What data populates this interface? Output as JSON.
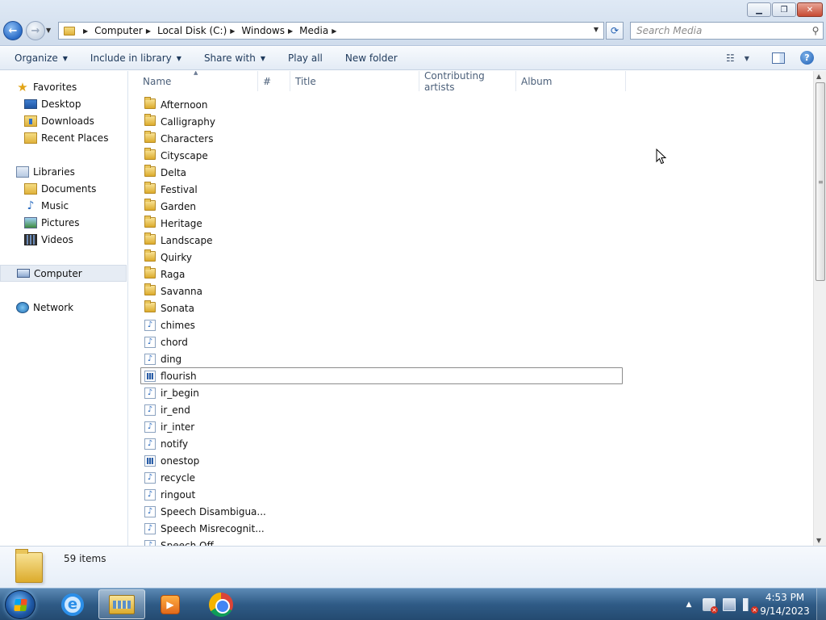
{
  "window": {
    "minimize_icon": "minimize-icon",
    "maximize_icon": "restore-icon",
    "close_icon": "close-icon",
    "minimize_glyph": "▁",
    "maximize_glyph": "❐",
    "close_glyph": "✕"
  },
  "nav_buttons": {
    "back_glyph": "←",
    "forward_glyph": "→",
    "recent_glyph": "▼"
  },
  "address": {
    "crumbs": [
      "Computer",
      "Local Disk (C:)",
      "Windows",
      "Media"
    ],
    "separator": "▶",
    "dropdown_glyph": "▼",
    "refresh_glyph": "⟳"
  },
  "search": {
    "placeholder": "Search Media",
    "icon_glyph": "⚲"
  },
  "toolbar": {
    "organize": "Organize",
    "include_in_library": "Include in library",
    "share_with": "Share with",
    "play_all": "Play all",
    "new_folder": "New folder",
    "caret": "▼",
    "views_glyph": "☷",
    "help_glyph": "?"
  },
  "nav_pane": {
    "favorites": {
      "label": "Favorites",
      "items": [
        "Desktop",
        "Downloads",
        "Recent Places"
      ]
    },
    "libraries": {
      "label": "Libraries",
      "items": [
        "Documents",
        "Music",
        "Pictures",
        "Videos"
      ]
    },
    "computer": "Computer",
    "network": "Network",
    "star_glyph": "★",
    "note_glyph": "♪"
  },
  "columns": [
    "Name",
    "#",
    "Title",
    "Contributing artists",
    "Album"
  ],
  "sort_glyph": "▲",
  "files": [
    {
      "name": "Afternoon",
      "type": "folder"
    },
    {
      "name": "Calligraphy",
      "type": "folder"
    },
    {
      "name": "Characters",
      "type": "folder"
    },
    {
      "name": "Cityscape",
      "type": "folder"
    },
    {
      "name": "Delta",
      "type": "folder"
    },
    {
      "name": "Festival",
      "type": "folder"
    },
    {
      "name": "Garden",
      "type": "folder"
    },
    {
      "name": "Heritage",
      "type": "folder"
    },
    {
      "name": "Landscape",
      "type": "folder"
    },
    {
      "name": "Quirky",
      "type": "folder"
    },
    {
      "name": "Raga",
      "type": "folder"
    },
    {
      "name": "Savanna",
      "type": "folder"
    },
    {
      "name": "Sonata",
      "type": "folder"
    },
    {
      "name": "chimes",
      "type": "audio"
    },
    {
      "name": "chord",
      "type": "audio"
    },
    {
      "name": "ding",
      "type": "audio"
    },
    {
      "name": "flourish",
      "type": "video",
      "focused": true
    },
    {
      "name": "ir_begin",
      "type": "audio"
    },
    {
      "name": "ir_end",
      "type": "audio"
    },
    {
      "name": "ir_inter",
      "type": "audio"
    },
    {
      "name": "notify",
      "type": "audio"
    },
    {
      "name": "onestop",
      "type": "video"
    },
    {
      "name": "recycle",
      "type": "audio"
    },
    {
      "name": "ringout",
      "type": "audio"
    },
    {
      "name": "Speech Disambigua...",
      "type": "audio"
    },
    {
      "name": "Speech Misrecognit...",
      "type": "audio"
    },
    {
      "name": "Speech Off",
      "type": "audio"
    }
  ],
  "scroll": {
    "up_glyph": "▲",
    "down_glyph": "▼",
    "grip_glyph": "≡",
    "thumb_fraction": 0.44
  },
  "status": {
    "item_count": "59 items"
  },
  "taskbar": {
    "apps": [
      "internet-explorer",
      "windows-explorer",
      "windows-media-player",
      "google-chrome"
    ],
    "ie_glyph": "e",
    "wmp_glyph": "▶",
    "tray_arrow": "▲",
    "clock_time": "4:53 PM",
    "clock_date": "9/14/2023"
  }
}
